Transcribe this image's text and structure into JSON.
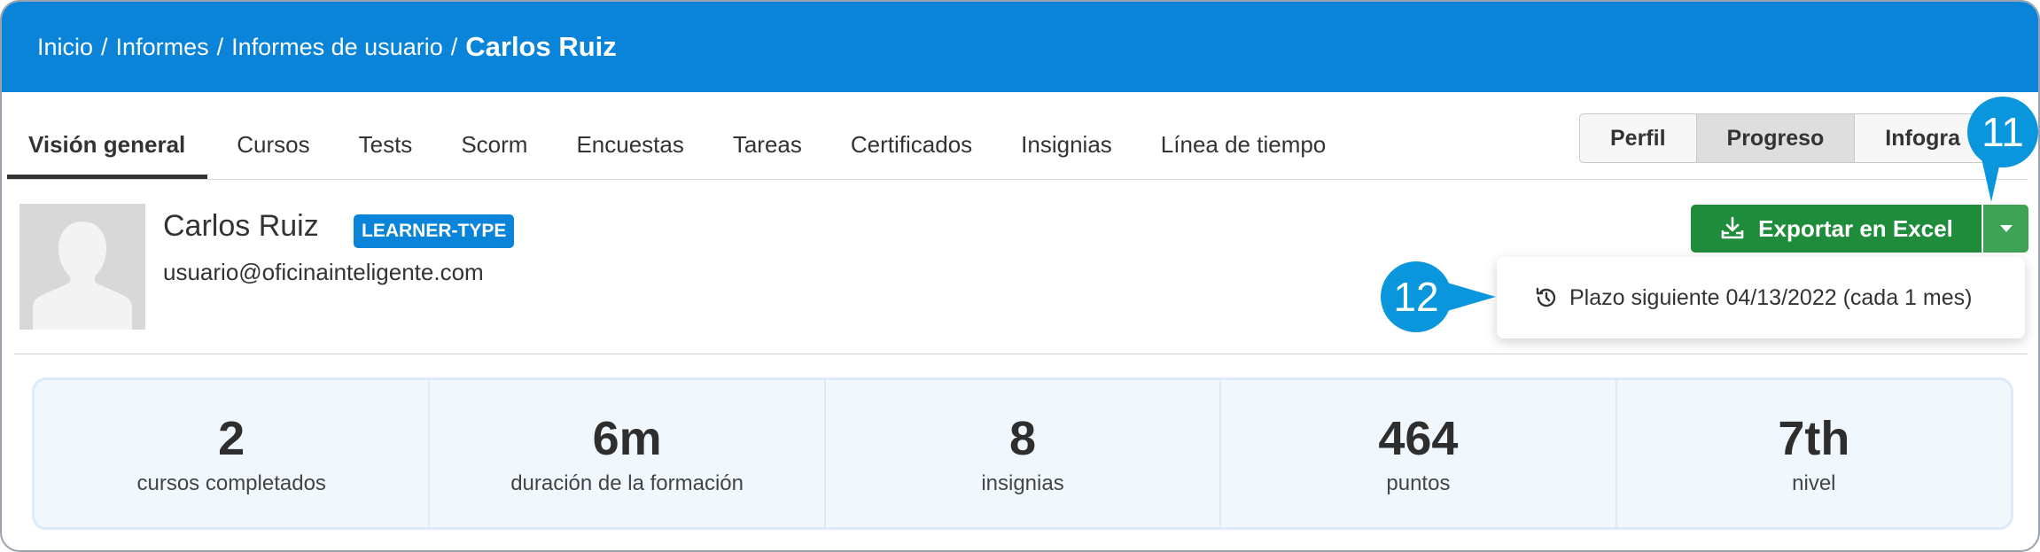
{
  "breadcrumb": {
    "items": [
      "Inicio",
      "Informes",
      "Informes de usuario"
    ],
    "separator": "/",
    "current": "Carlos Ruiz"
  },
  "tabs": [
    {
      "label": "Visión general",
      "active": true
    },
    {
      "label": "Cursos"
    },
    {
      "label": "Tests"
    },
    {
      "label": "Scorm"
    },
    {
      "label": "Encuestas"
    },
    {
      "label": "Tareas"
    },
    {
      "label": "Certificados"
    },
    {
      "label": "Insignias"
    },
    {
      "label": "Línea de tiempo"
    }
  ],
  "view_toggle": {
    "options": [
      "Perfil",
      "Progreso",
      "Infogra"
    ],
    "selected": "Progreso"
  },
  "user": {
    "name": "Carlos Ruiz",
    "badge": "LEARNER-TYPE",
    "email": "usuario@oficinainteligente.com",
    "avatar_icon": "user-silhouette-icon"
  },
  "export": {
    "label": "Exportar en Excel",
    "icon": "download-tray-icon",
    "dropdown_icon": "caret-down-icon"
  },
  "schedule_menu": {
    "icon": "history-clock-icon",
    "label": "Plazo siguiente 04/13/2022 (cada 1 mes)"
  },
  "callouts": {
    "first": "11",
    "second": "12"
  },
  "stats": [
    {
      "value": "2",
      "label": "cursos completados"
    },
    {
      "value": "6m",
      "label": "duración de la formación"
    },
    {
      "value": "8",
      "label": "insignias"
    },
    {
      "value": "464",
      "label": "puntos"
    },
    {
      "value": "7th",
      "label": "nivel"
    }
  ],
  "colors": {
    "header_blue": "#0a84d8",
    "export_green": "#1f8c3b",
    "callout_blue": "#0a96dc",
    "stats_bg": "#f0f7fd"
  }
}
